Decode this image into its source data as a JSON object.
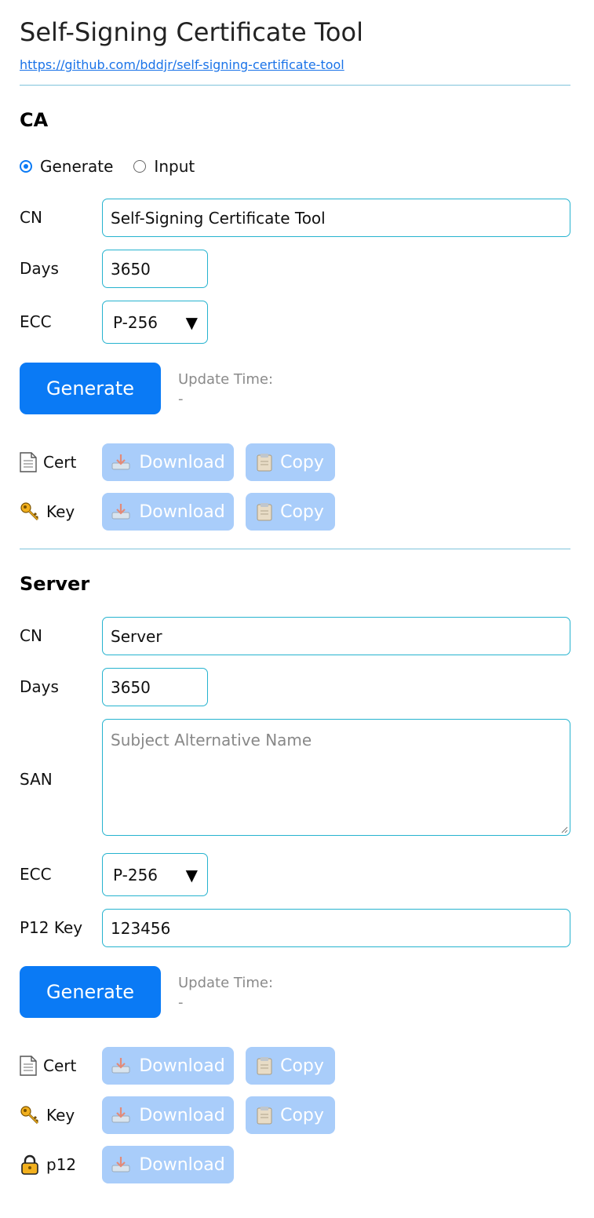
{
  "header": {
    "title": "Self-Signing Certificate Tool",
    "repo_link": "https://github.com/bddjr/self-signing-certificate-tool"
  },
  "ca": {
    "heading": "CA",
    "mode_options": [
      "Generate",
      "Input"
    ],
    "mode_selected": "Generate",
    "cn_label": "CN",
    "cn_value": "Self-Signing Certificate Tool",
    "days_label": "Days",
    "days_value": "3650",
    "ecc_label": "ECC",
    "ecc_value": "P-256",
    "generate_label": "Generate",
    "update_time_label": "Update Time:",
    "update_time_value": "-",
    "cert_label": "Cert",
    "key_label": "Key",
    "download_label": "Download",
    "copy_label": "Copy"
  },
  "server": {
    "heading": "Server",
    "cn_label": "CN",
    "cn_value": "Server",
    "days_label": "Days",
    "days_value": "3650",
    "san_label": "SAN",
    "san_placeholder": "Subject Alternative Name",
    "ecc_label": "ECC",
    "ecc_value": "P-256",
    "p12key_label": "P12 Key",
    "p12key_value": "123456",
    "generate_label": "Generate",
    "update_time_label": "Update Time:",
    "update_time_value": "-",
    "cert_label": "Cert",
    "key_label": "Key",
    "p12_label": "p12",
    "download_label": "Download",
    "copy_label": "Copy"
  },
  "colors": {
    "primary": "#0a7af5",
    "disabled_button": "#a9cdfa",
    "input_border": "#26b3cf",
    "divider": "#7fc4dc",
    "link": "#1a73e8"
  },
  "icons": {
    "cert": "page-icon",
    "key": "key-icon",
    "p12": "lock-icon",
    "download": "download-tray-icon",
    "copy": "clipboard-icon"
  }
}
